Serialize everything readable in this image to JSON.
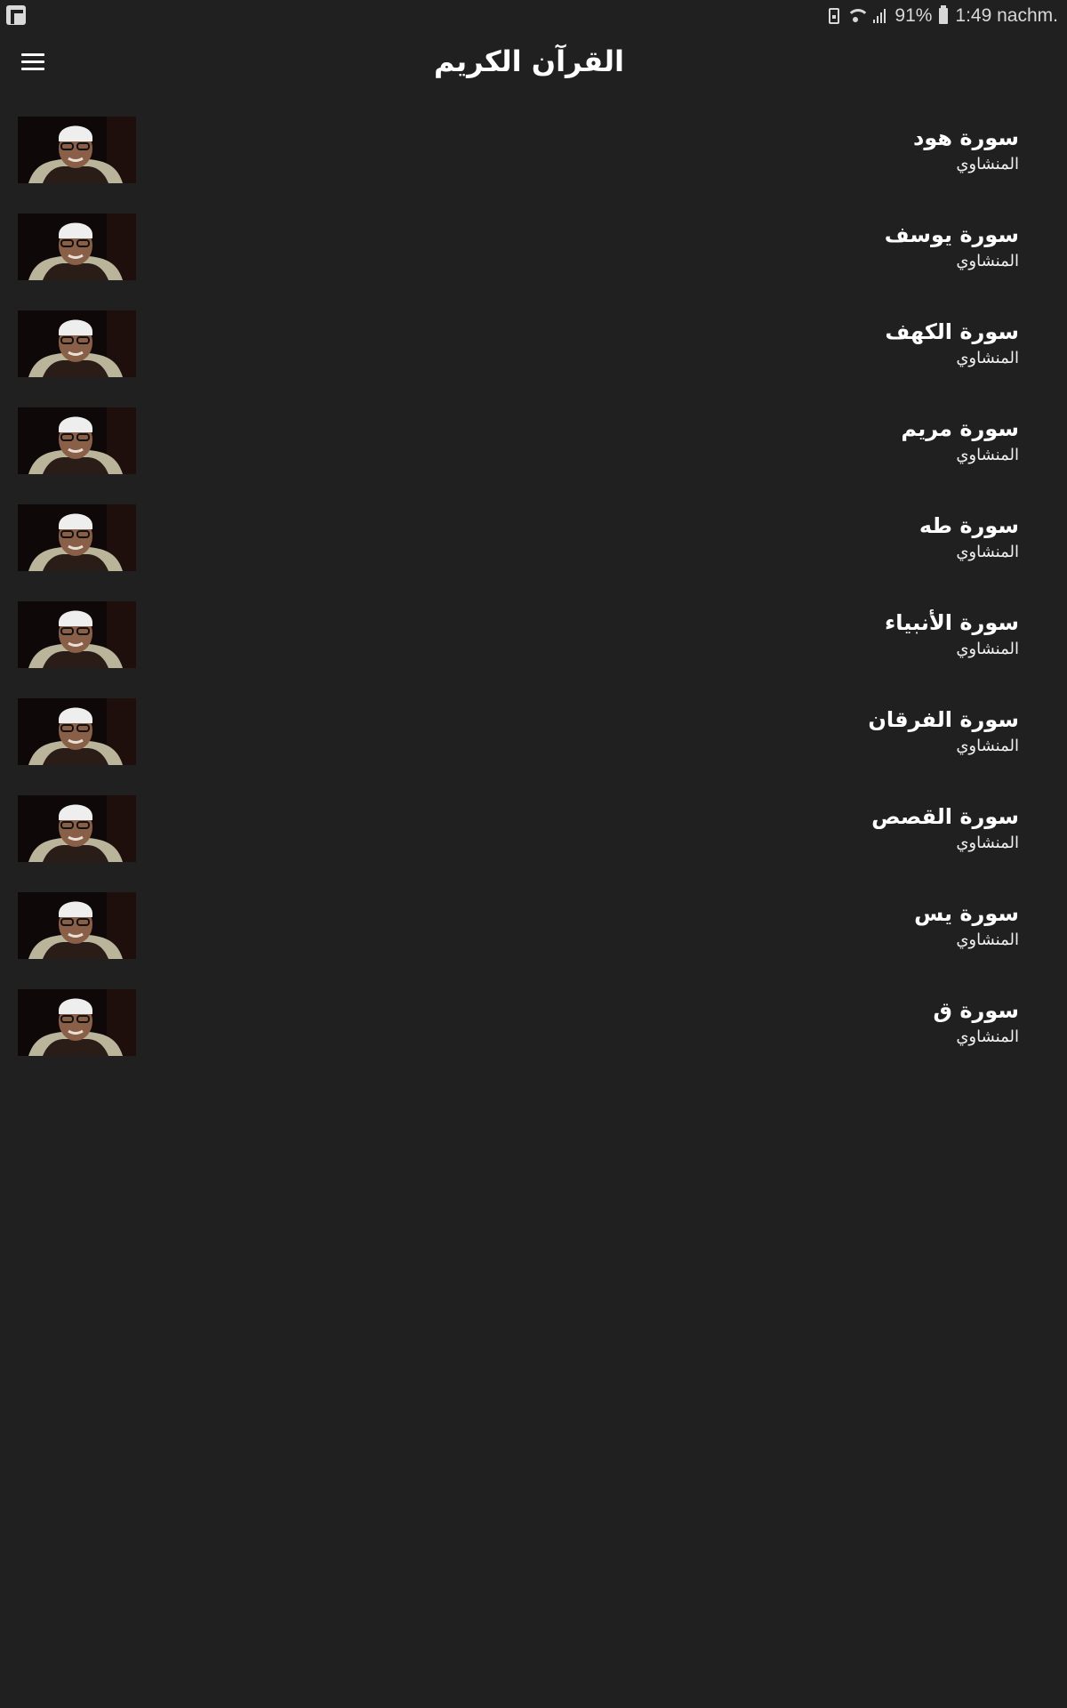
{
  "status_bar": {
    "battery_percent": "91%",
    "time": "1:49 nachm."
  },
  "header": {
    "title": "القرآن الكريم",
    "menu_icon": "hamburger-menu-icon"
  },
  "colors": {
    "background": "#202020",
    "text": "#ffffff"
  },
  "surahs": [
    {
      "title": "سورة هود",
      "reciter": "المنشاوي"
    },
    {
      "title": "سورة يوسف",
      "reciter": "المنشاوي"
    },
    {
      "title": "سورة الكهف",
      "reciter": "المنشاوي"
    },
    {
      "title": "سورة مريم",
      "reciter": "المنشاوي"
    },
    {
      "title": "سورة طه",
      "reciter": "المنشاوي"
    },
    {
      "title": "سورة الأنبياء",
      "reciter": "المنشاوي"
    },
    {
      "title": "سورة الفرقان",
      "reciter": "المنشاوي"
    },
    {
      "title": "سورة القصص",
      "reciter": "المنشاوي"
    },
    {
      "title": "سورة يس",
      "reciter": "المنشاوي"
    },
    {
      "title": "سورة ق",
      "reciter": "المنشاوي"
    }
  ]
}
